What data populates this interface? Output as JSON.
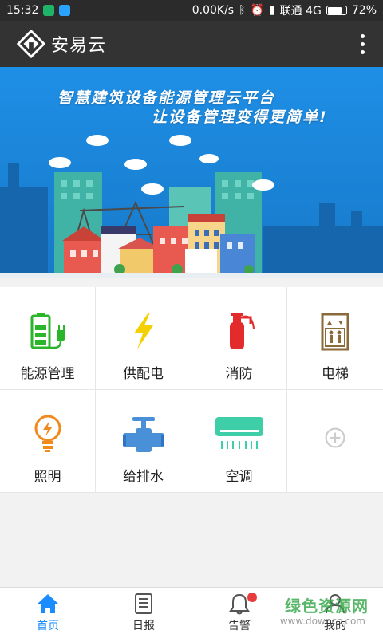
{
  "status_bar": {
    "time": "15:32",
    "speed": "0.00K/s",
    "carrier": "联通 4G",
    "battery": "72%"
  },
  "app_bar": {
    "title": "安易云",
    "logo_icon": "anyiyun-logo-icon",
    "menu_icon": "overflow-menu-icon"
  },
  "banner": {
    "line1": "智慧建筑设备能源管理云平台",
    "line2": "让设备管理变得更简单!",
    "colors": {
      "sky": "#1a8ae0"
    }
  },
  "grid": {
    "items": [
      {
        "label": "能源管理",
        "icon": "battery-plug-icon",
        "color": "#2bb52b"
      },
      {
        "label": "供配电",
        "icon": "lightning-icon",
        "color": "#f5d000"
      },
      {
        "label": "消防",
        "icon": "fire-extinguisher-icon",
        "color": "#e32b2b"
      },
      {
        "label": "电梯",
        "icon": "elevator-icon",
        "color": "#8a6a3a"
      },
      {
        "label": "照明",
        "icon": "light-bulb-icon",
        "color": "#f08a1c"
      },
      {
        "label": "给排水",
        "icon": "water-pipe-icon",
        "color": "#4a90d9"
      },
      {
        "label": "空调",
        "icon": "air-conditioner-icon",
        "color": "#3ecfa8"
      },
      {
        "label": "",
        "icon": "add-icon",
        "color": "#cccccc"
      }
    ]
  },
  "bottom_nav": {
    "tabs": [
      {
        "label": "首页",
        "icon": "home-icon",
        "active": true
      },
      {
        "label": "日报",
        "icon": "daily-report-icon",
        "active": false
      },
      {
        "label": "告警",
        "icon": "bell-icon",
        "active": false
      },
      {
        "label": "我的",
        "icon": "user-icon",
        "active": false
      }
    ],
    "active_color": "#1a8cff"
  },
  "watermark": {
    "text": "绿色资源网",
    "sub": "www.downcc.com"
  }
}
